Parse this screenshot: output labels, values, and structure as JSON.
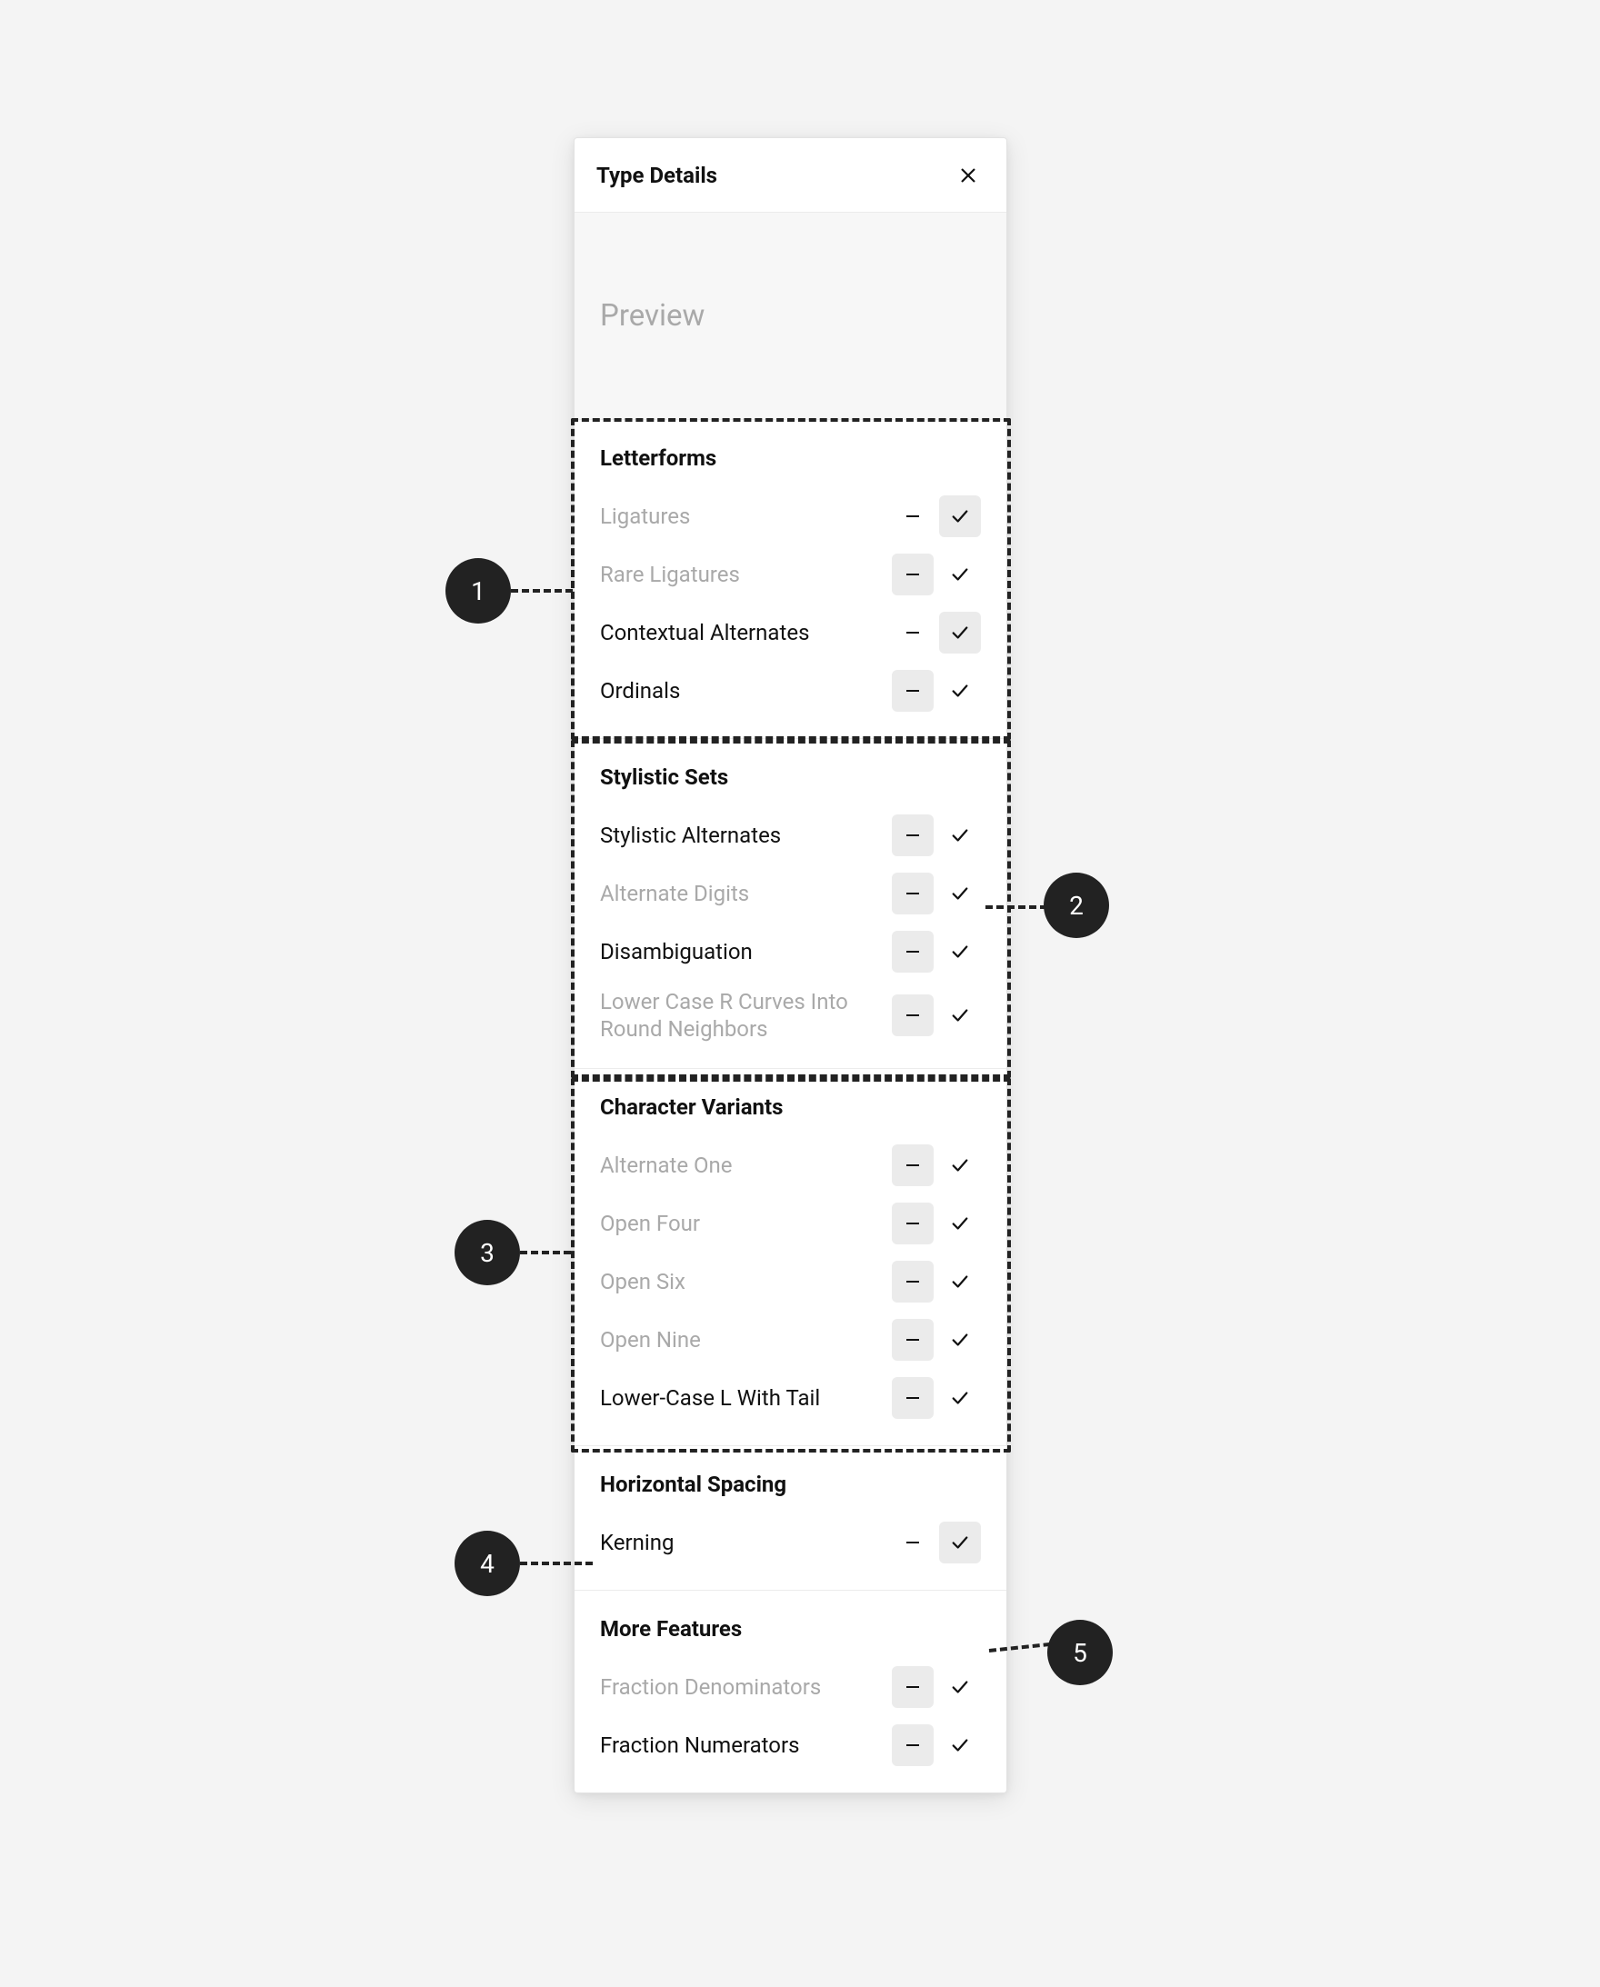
{
  "header": {
    "title": "Type Details"
  },
  "preview": {
    "label": "Preview"
  },
  "sections": {
    "letterforms": {
      "title": "Letterforms",
      "rows": [
        {
          "label": "Ligatures",
          "muted": true,
          "active": "check"
        },
        {
          "label": "Rare Ligatures",
          "muted": true,
          "active": "dash"
        },
        {
          "label": "Contextual Alternates",
          "muted": false,
          "active": "check"
        },
        {
          "label": "Ordinals",
          "muted": false,
          "active": "dash"
        }
      ]
    },
    "stylistic": {
      "title": "Stylistic Sets",
      "rows": [
        {
          "label": "Stylistic Alternates",
          "muted": false,
          "active": "dash"
        },
        {
          "label": "Alternate Digits",
          "muted": true,
          "active": "dash"
        },
        {
          "label": "Disambiguation",
          "muted": false,
          "active": "dash"
        },
        {
          "label": "Lower Case R Curves Into Round Neighbors",
          "muted": true,
          "active": "dash"
        }
      ]
    },
    "variants": {
      "title": "Character Variants",
      "rows": [
        {
          "label": "Alternate One",
          "muted": true,
          "active": "dash"
        },
        {
          "label": "Open Four",
          "muted": true,
          "active": "dash"
        },
        {
          "label": "Open Six",
          "muted": true,
          "active": "dash"
        },
        {
          "label": "Open Nine",
          "muted": true,
          "active": "dash"
        },
        {
          "label": "Lower-Case L With Tail",
          "muted": false,
          "active": "dash"
        }
      ]
    },
    "spacing": {
      "title": "Horizontal Spacing",
      "rows": [
        {
          "label": "Kerning",
          "muted": false,
          "active": "check"
        }
      ]
    },
    "more": {
      "title": "More Features",
      "rows": [
        {
          "label": "Fraction Denominators",
          "muted": true,
          "active": "dash"
        },
        {
          "label": "Fraction Numerators",
          "muted": false,
          "active": "dash"
        }
      ]
    }
  },
  "annotations": {
    "pins": [
      "1",
      "2",
      "3",
      "4",
      "5"
    ]
  }
}
